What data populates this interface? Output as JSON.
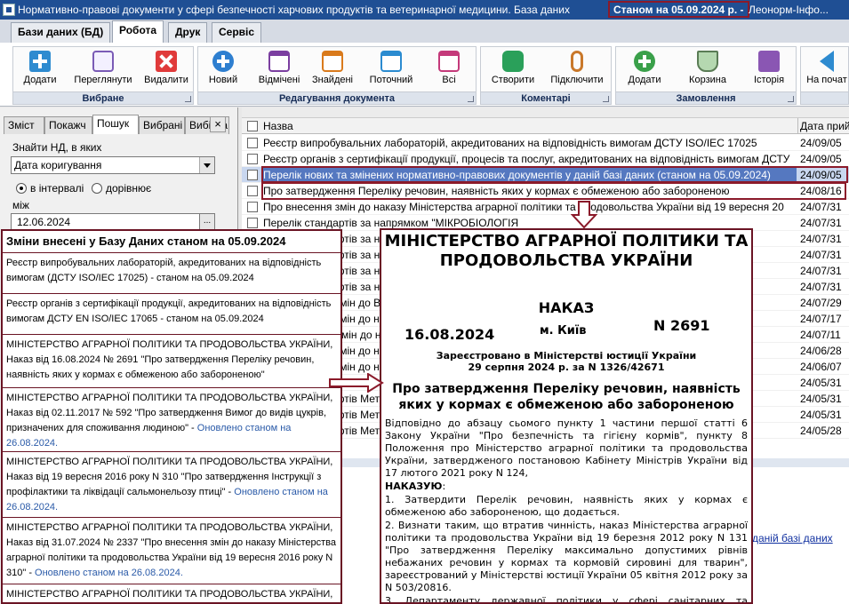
{
  "window": {
    "title": "Нормативно-правові документи у сфері безпечності харчових продуктів та ветеринарної медицини. База даних",
    "status_stamp": "Станом на 05.09.2024 р. -",
    "title_tail": "Леонорм-Інфо..."
  },
  "menu_tabs": [
    "Бази даних (БД)",
    "Робота",
    "Друк",
    "Сервіс"
  ],
  "ribbon": {
    "groups": [
      {
        "label": "Вибране",
        "buttons": [
          {
            "label": "Додати",
            "icon": "plus-icon"
          },
          {
            "label": "Переглянути",
            "icon": "document-icon"
          },
          {
            "label": "Видалити",
            "icon": "delete-icon"
          }
        ]
      },
      {
        "label": "Редагування документа",
        "buttons": [
          {
            "label": "Новий",
            "icon": "new-icon"
          },
          {
            "label": "Відмічені",
            "icon": "marked-icon"
          },
          {
            "label": "Знайдені",
            "icon": "found-icon"
          },
          {
            "label": "Поточний",
            "icon": "current-icon"
          },
          {
            "label": "Всі",
            "icon": "all-icon"
          }
        ]
      },
      {
        "label": "Коментарі",
        "buttons": [
          {
            "label": "Створити",
            "icon": "comment-icon"
          },
          {
            "label": "Підключити",
            "icon": "paperclip-icon"
          }
        ]
      },
      {
        "label": "Замовлення",
        "buttons": [
          {
            "label": "Додати",
            "icon": "add-order-icon"
          },
          {
            "label": "Корзина",
            "icon": "basket-icon"
          },
          {
            "label": "Історія",
            "icon": "history-icon"
          }
        ]
      },
      {
        "label": "",
        "buttons": [
          {
            "label": "На почат",
            "icon": "arrow-left-icon"
          }
        ]
      }
    ]
  },
  "left_panel": {
    "tabs": [
      "Зміст",
      "Покажч",
      "Пошук",
      "Вибрані",
      "Вибірка"
    ],
    "close_glyph": "×",
    "find_label": "Знайти НД, в яких",
    "find_select": "Дата коригування",
    "radio_interval": "в інтервалі",
    "radio_equal": "дорівнює",
    "between_label": "між",
    "date_from": "12.06.2024",
    "date_btn": "..."
  },
  "list": {
    "col_name": "Назва",
    "col_date": "Дата прий",
    "rows": [
      {
        "title": "Реєстр випробувальних лабораторій, акредитованих на відповідність вимогам ДСТУ ISO/IEC 17025",
        "date": "24/09/05"
      },
      {
        "title": "Реєстр органів з сертифікації продукції, процесів та послуг, акредитованих на відповідність вимогам ДСТУ",
        "date": "24/09/05"
      },
      {
        "title": "Перелік нових та змінених нормативно-правових документів у даній базі даних (станом на  05.09.2024)",
        "date": "24/09/05"
      },
      {
        "title": "Про затвердження Переліку речовин, наявність яких у кормах є обмеженою або забороненою",
        "date": "24/08/16"
      },
      {
        "title": "Про внесення змін до наказу Міністерства аграрної політики та продовольства України від 19 вересня 20",
        "date": "24/07/31"
      },
      {
        "title": "Перелік стандартів за напрямком \"МІКРОБІОЛОГІЯ",
        "date": "24/07/31"
      },
      {
        "title": "Перелік стандартів за напрямком",
        "date": "24/07/31"
      },
      {
        "title": "Перелік стандартів за напрямком",
        "date": "24/07/31"
      },
      {
        "title": "Перелік стандартів за напрямком",
        "date": "24/07/31"
      },
      {
        "title": "Перелік стандартів за напрямком",
        "date": "24/07/31"
      },
      {
        "title": "Про внесення змін до Вимог до коневи",
        "date": "24/07/29"
      },
      {
        "title": "Про внесення змін до наказу від листопада",
        "date": "24/07/17"
      },
      {
        "title": "Про внесення Змін до наказу від 2 березн",
        "date": "24/07/11"
      },
      {
        "title": "Про внесення змін до наказу 2",
        "date": "24/06/28"
      },
      {
        "title": "Про внесення змін до наказу 92",
        "date": "24/06/07"
      },
      {
        "title": "Перелік стандартів Мет ачення",
        "date": "24/05/31"
      },
      {
        "title": "Перелік стандартів Мет ачення",
        "date": "24/05/31"
      },
      {
        "title": "Перелік стандартів Мет ачення",
        "date": "24/05/31"
      },
      {
        "title": "Перелік стандартів Мет",
        "date": "24/05/28"
      }
    ],
    "link_text": "даній базі даних"
  },
  "changes_panel": {
    "title": "Зміни внесені у Базу Даних станом на 05.09.2024",
    "entries": [
      {
        "text": "Реєстр випробувальних лабораторій, акредитованих на відповідність вимогам (ДСТУ ISO/IEC 17025)  - станом на  05.09.2024",
        "updated": ""
      },
      {
        "text": "Реєстр органів з сертифікації продукції, акредитованих на відповідність вимогам ДСТУ EN ISO/IEC 17065 - станом на  05.09.2024",
        "updated": ""
      },
      {
        "text": "МІНІСТЕРСТВО АГРАРНОЇ ПОЛІТИКИ ТА ПРОДОВОЛЬСТВА УКРАЇНИ, Наказ від 16.08.2024 № 2691 \"Про затвердження Переліку речовин, наявність яких у кормах є обмеженою  або забороненою\"",
        "updated": ""
      },
      {
        "text": "МІНІСТЕРСТВО АГРАРНОЇ ПОЛІТИКИ ТА ПРОДОВОЛЬСТВА УКРАЇНИ, Наказ від 02.11.2017 № 592 \"Про затвердження  Вимог до видів цукрів, призначених для споживання людиною\" - ",
        "updated": "Оновлено  станом на 26.08.2024."
      },
      {
        "text": "МІНІСТЕРСТВО АГРАРНОЇ ПОЛІТИКИ ТА ПРОДОВОЛЬСТВА УКРАЇНИ, Наказ від 19 вересня  2016 року N 310 \"Про затвердження Інструкції з профілактики та ліквідації сальмонельозу птиці\" - ",
        "updated": "Оновлено  станом на 26.08.2024."
      },
      {
        "text": "МІНІСТЕРСТВО АГРАРНОЇ ПОЛІТИКИ ТА ПРОДОВОЛЬСТВА УКРАЇНИ, Наказ від 31.07.2024 № 2337 \"Про внесення змін до наказу Міністерства аграрної  політики та продовольства України від 19 вересня 2016 року N 310\" - ",
        "updated": "Оновлено  станом на 26.08.2024."
      },
      {
        "text": "МІНІСТЕРСТВО АГРАРНОЇ ПОЛІТИКИ ТА ПРОДОВОЛЬСТВА УКРАЇНИ,",
        "updated": ""
      }
    ]
  },
  "order_doc": {
    "ministry": "МІНІСТЕРСТВО АГРАРНОЇ ПОЛІТИКИ ТА ПРОДОВОЛЬСТВА УКРАЇНИ",
    "doc_type": "НАКАЗ",
    "date": "16.08.2024",
    "city": "м. Київ",
    "number": "N 2691",
    "reg_line1": "Зареєстровано в Міністерстві юстиції України",
    "reg_line2": "29 серпня 2024 р. за N 1326/42671",
    "title": "Про затвердження Переліку речовин, наявність яких у кормах є обмеженою або забороненою",
    "intro": "Відповідно до абзацу сьомого пункту 1 частини першої статті 6 Закону України \"Про безпечність та гігієну кормів\", пункту 8 Положення про Міністерство аграрної політики та продовольства України, затвердженого постановою Кабінету Міністрів України від 17 лютого 2021 року N 124,",
    "order_word": "НАКАЗУЮ",
    "p1": "1. Затвердити Перелік речовин, наявність яких у кормах є обмеженою або забороненою, що додається.",
    "p2": "2. Визнати таким, що втратив чинність, наказ Міністерства аграрної політики та продовольства України від 19 березня 2012 року N 131 \"Про затвердження Переліку максимально допустимих рівнів небажаних речовин у кормах та кормовій сировині для тварин\", зареєстрований у Міністерстві юстиції України 05 квітня 2012 року за N 503/20816.",
    "p3": "3. Департаменту державної політики у сфері санітарних та фітосанітарних заходів і продовольчої безпеки забезпечити в"
  }
}
